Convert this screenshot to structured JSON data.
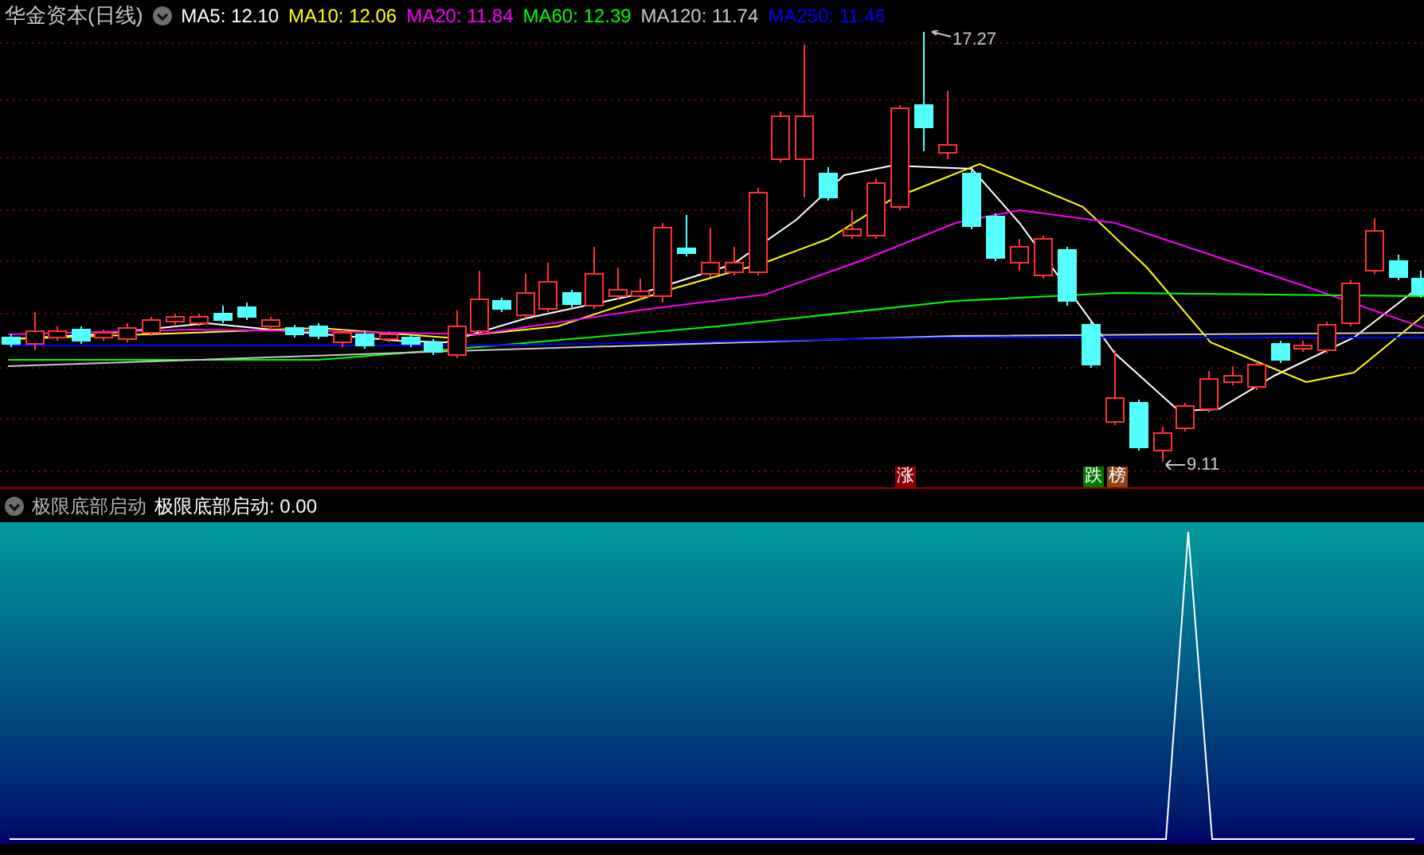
{
  "chart": {
    "title": "华金资本(日线)",
    "ma_legend": [
      {
        "label": "MA5: 12.10",
        "color": "#ffffff"
      },
      {
        "label": "MA10: 12.06",
        "color": "#ffff00"
      },
      {
        "label": "MA20: 11.84",
        "color": "#ff00ff"
      },
      {
        "label": "MA60: 12.39",
        "color": "#00ff00"
      },
      {
        "label": "MA120: 11.74",
        "color": "#c8c8c8"
      },
      {
        "label": "MA250: 11.46",
        "color": "#0000ff"
      }
    ],
    "high_label": "17.27",
    "low_label": "9.11",
    "event_tags": [
      {
        "text": "涨",
        "color": "#8b0000"
      },
      {
        "text": "跌",
        "color": "#007800"
      },
      {
        "text": "榜",
        "color": "#8b4513"
      }
    ]
  },
  "indicator": {
    "name": "极限底部启动",
    "reading": "极限底部启动: 0.00"
  }
}
